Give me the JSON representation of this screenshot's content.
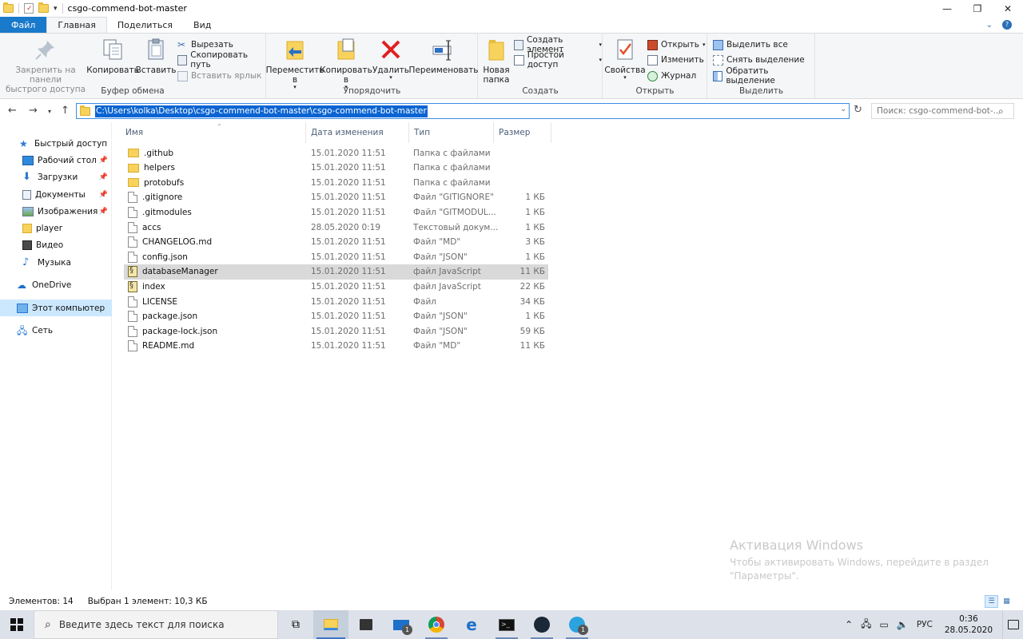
{
  "window": {
    "title": "csgo-commend-bot-master"
  },
  "tabs": [
    "Файл",
    "Главная",
    "Поделиться",
    "Вид"
  ],
  "ribbon": {
    "clipboard": {
      "group_name": "Буфер обмена",
      "pin_label_1": "Закрепить на панели",
      "pin_label_2": "быстрого доступа",
      "copy": "Копировать",
      "paste": "Вставить",
      "cut": "Вырезать",
      "copy_path": "Скопировать путь",
      "paste_shortcut": "Вставить ярлык"
    },
    "organize": {
      "group_name": "Упорядочить",
      "move_1": "Переместить",
      "move_2": "в",
      "copy_1": "Копировать",
      "copy_2": "в",
      "delete": "Удалить",
      "rename": "Переименовать"
    },
    "create": {
      "group_name": "Создать",
      "new_folder_1": "Новая",
      "new_folder_2": "папка",
      "new_item": "Создать элемент",
      "easy_access": "Простой доступ"
    },
    "open": {
      "group_name": "Открыть",
      "properties": "Свойства",
      "open": "Открыть",
      "edit": "Изменить",
      "history": "Журнал"
    },
    "select": {
      "group_name": "Выделить",
      "select_all": "Выделить все",
      "select_none": "Снять выделение",
      "invert": "Обратить выделение"
    }
  },
  "address": {
    "path": "C:\\Users\\kolka\\Desktop\\csgo-commend-bot-master\\csgo-commend-bot-master",
    "search_placeholder": "Поиск: csgo-commend-bot-..."
  },
  "nav": [
    {
      "label": "Быстрый доступ",
      "icon": "star-icon",
      "pinned": false
    },
    {
      "label": "Рабочий стол",
      "icon": "desktop-icon",
      "pinned": true
    },
    {
      "label": "Загрузки",
      "icon": "download-icon",
      "pinned": true
    },
    {
      "label": "Документы",
      "icon": "documents-icon",
      "pinned": true
    },
    {
      "label": "Изображения",
      "icon": "pictures-icon",
      "pinned": true
    },
    {
      "label": "player",
      "icon": "folder-icon",
      "pinned": false
    },
    {
      "label": "Видео",
      "icon": "video-icon",
      "pinned": false
    },
    {
      "label": "Музыка",
      "icon": "music-icon",
      "pinned": false
    },
    {
      "label": "OneDrive",
      "icon": "cloud-icon",
      "pinned": false
    },
    {
      "label": "Этот компьютер",
      "icon": "computer-icon",
      "pinned": false
    },
    {
      "label": "Сеть",
      "icon": "network-icon",
      "pinned": false
    }
  ],
  "columns": {
    "name": "Имя",
    "date": "Дата изменения",
    "type": "Тип",
    "size": "Размер"
  },
  "files": [
    {
      "name": ".github",
      "date": "15.01.2020 11:51",
      "type": "Папка с файлами",
      "size": "",
      "kind": "folder"
    },
    {
      "name": "helpers",
      "date": "15.01.2020 11:51",
      "type": "Папка с файлами",
      "size": "",
      "kind": "folder"
    },
    {
      "name": "protobufs",
      "date": "15.01.2020 11:51",
      "type": "Папка с файлами",
      "size": "",
      "kind": "folder"
    },
    {
      "name": ".gitignore",
      "date": "15.01.2020 11:51",
      "type": "Файл \"GITIGNORE\"",
      "size": "1 КБ",
      "kind": "file"
    },
    {
      "name": ".gitmodules",
      "date": "15.01.2020 11:51",
      "type": "Файл \"GITMODUL...",
      "size": "1 КБ",
      "kind": "file"
    },
    {
      "name": "accs",
      "date": "28.05.2020 0:19",
      "type": "Текстовый докум...",
      "size": "1 КБ",
      "kind": "file"
    },
    {
      "name": "CHANGELOG.md",
      "date": "15.01.2020 11:51",
      "type": "Файл \"MD\"",
      "size": "3 КБ",
      "kind": "file"
    },
    {
      "name": "config.json",
      "date": "15.01.2020 11:51",
      "type": "Файл \"JSON\"",
      "size": "1 КБ",
      "kind": "file"
    },
    {
      "name": "databaseManager",
      "date": "15.01.2020 11:51",
      "type": "файл JavaScript",
      "size": "11 КБ",
      "kind": "js",
      "selected": true
    },
    {
      "name": "index",
      "date": "15.01.2020 11:51",
      "type": "файл JavaScript",
      "size": "22 КБ",
      "kind": "js"
    },
    {
      "name": "LICENSE",
      "date": "15.01.2020 11:51",
      "type": "Файл",
      "size": "34 КБ",
      "kind": "file"
    },
    {
      "name": "package.json",
      "date": "15.01.2020 11:51",
      "type": "Файл \"JSON\"",
      "size": "1 КБ",
      "kind": "file"
    },
    {
      "name": "package-lock.json",
      "date": "15.01.2020 11:51",
      "type": "Файл \"JSON\"",
      "size": "59 КБ",
      "kind": "file"
    },
    {
      "name": "README.md",
      "date": "15.01.2020 11:51",
      "type": "Файл \"MD\"",
      "size": "11 КБ",
      "kind": "file"
    }
  ],
  "status": {
    "count": "Элементов: 14",
    "selection": "Выбран 1 элемент: 10,3 КБ"
  },
  "watermark": {
    "line1": "Активация Windows",
    "line2": "Чтобы активировать Windows, перейдите в раздел",
    "line3": "\"Параметры\"."
  },
  "taskbar": {
    "search_placeholder": "Введите здесь текст для поиска",
    "lang": "РУС",
    "time": "0:36",
    "date": "28.05.2020",
    "mail_badge": "1",
    "telegram_badge": "1"
  },
  "colors": {
    "accent": "#1979ca",
    "selection": "#0a64d2",
    "nav_selected": "#cce8ff"
  }
}
